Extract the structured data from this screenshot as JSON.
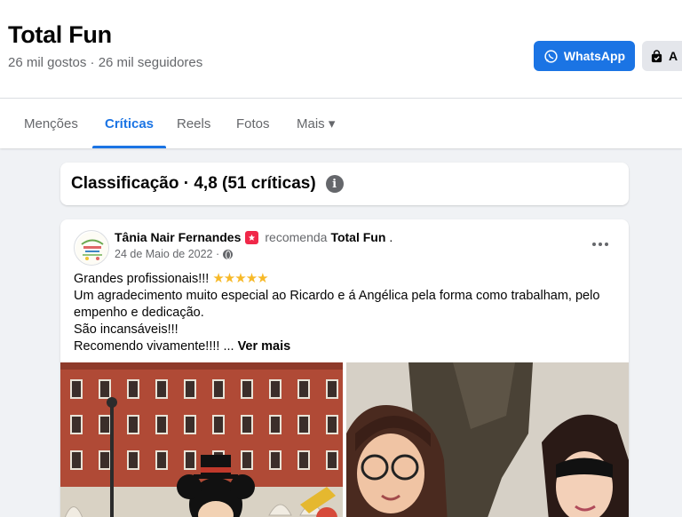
{
  "page": {
    "name": "Total Fun",
    "stats": "26 mil gostos · 26 mil seguidores",
    "whatsapp_label": "WhatsApp",
    "secondary_button_label": "A"
  },
  "tabs": [
    {
      "label": "Menções"
    },
    {
      "label": "Críticas"
    },
    {
      "label": "Reels"
    },
    {
      "label": "Fotos"
    },
    {
      "label": "Mais ▾"
    }
  ],
  "rating": {
    "title": "Classificação · 4,8 (51 críticas)",
    "info_glyph": "i"
  },
  "review": {
    "author": "Tânia Nair Fernandes",
    "recommends": "recomenda",
    "page": "Total Fun",
    "date": "24 de Maio de 2022 ·",
    "line1": "Grandes profissionais!!!",
    "stars": "★★★★★",
    "line2": "Um agradecimento muito especial ao Ricardo e á Angélica pela forma como trabalham, pelo empenho e dedicação.",
    "line3": "São incansáveis!!!",
    "line4": "Recomendo vivamente!!!! ...",
    "see_more": "Ver mais"
  },
  "colors": {
    "accent": "#1b74e4",
    "secondary_text": "#65676b",
    "background": "#f0f2f5",
    "star": "#f7b928",
    "recommend_badge": "#f02849"
  },
  "icons": {
    "whatsapp": "whatsapp-icon",
    "bag": "shopping-bag-icon",
    "info": "info-icon",
    "recommend": "recommend-badge-icon",
    "globe": "globe-icon",
    "more": "more-options-icon"
  }
}
